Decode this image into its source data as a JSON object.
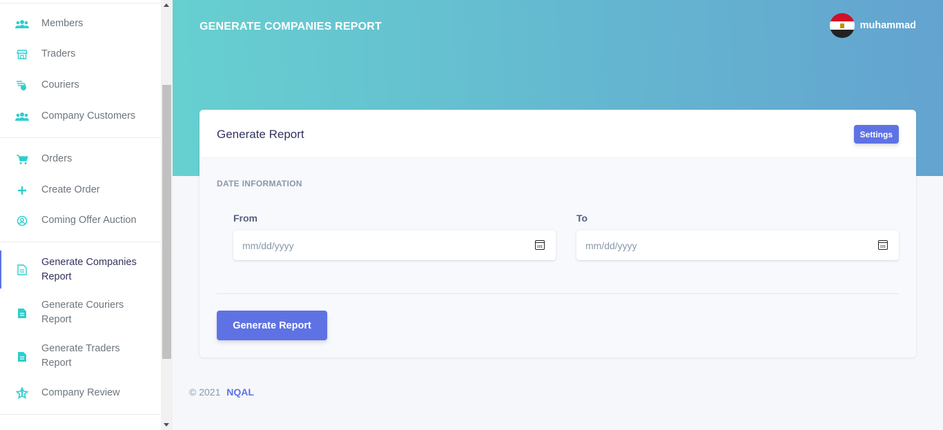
{
  "sidebar": {
    "items": [
      {
        "label": "Members",
        "icon": "users-icon"
      },
      {
        "label": "Traders",
        "icon": "store-icon"
      },
      {
        "label": "Couriers",
        "icon": "delivery-icon"
      },
      {
        "label": "Company Customers",
        "icon": "users-icon"
      },
      {
        "label": "Orders",
        "icon": "cart-icon"
      },
      {
        "label": "Create Order",
        "icon": "plus-icon"
      },
      {
        "label": "Coming Offer Auction",
        "icon": "user-circle-icon"
      },
      {
        "label": "Generate Companies Report",
        "icon": "document-icon",
        "active": true
      },
      {
        "label": "Generate Couriers Report",
        "icon": "document-icon"
      },
      {
        "label": "Generate Traders Report",
        "icon": "document-icon"
      },
      {
        "label": "Company Review",
        "icon": "star-icon"
      }
    ]
  },
  "header": {
    "title": "GENERATE COMPANIES REPORT",
    "username": "muhammad"
  },
  "card": {
    "title": "Generate Report",
    "settings_label": "Settings",
    "section": "DATE INFORMATION",
    "from_label": "From",
    "from_placeholder": "mm/dd/yyyy",
    "to_label": "To",
    "to_placeholder": "mm/dd/yyyy",
    "generate_label": "Generate Report"
  },
  "footer": {
    "copyright": "© 2021",
    "brand": "NQAL"
  },
  "colors": {
    "accent": "#5e72e4",
    "teal": "#66d0d0",
    "hero_end": "#63a3d0"
  }
}
